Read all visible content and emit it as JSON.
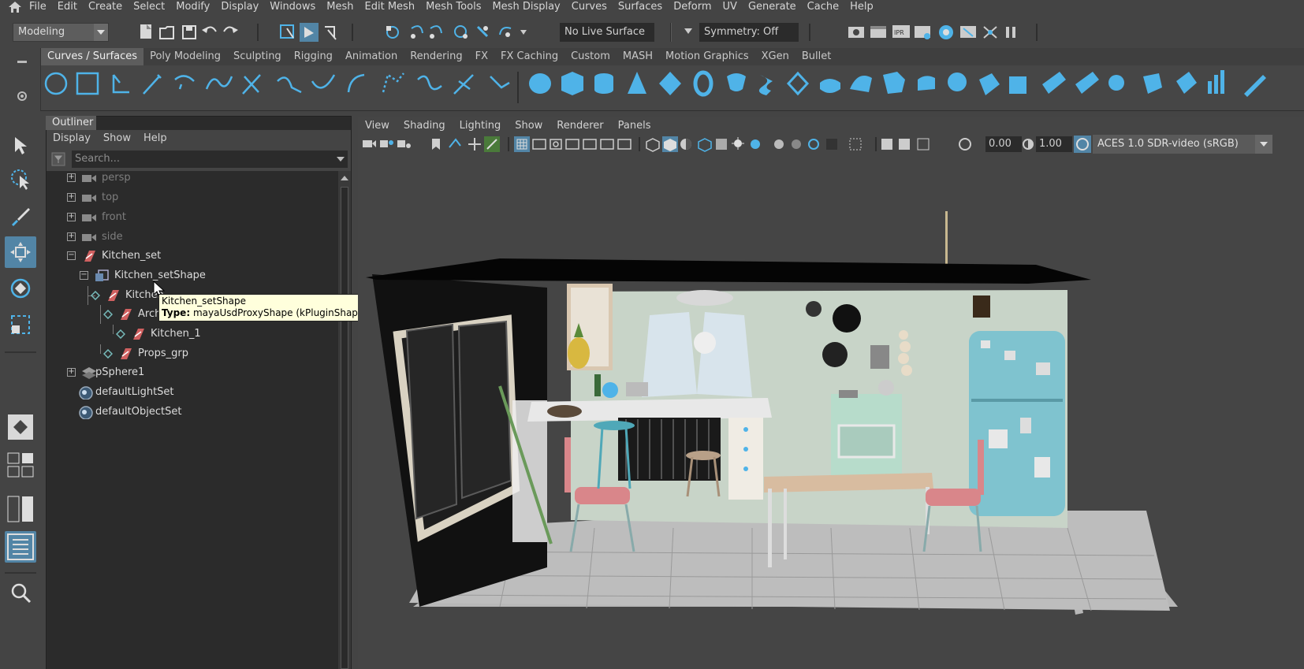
{
  "menubar": {
    "items": [
      "File",
      "Edit",
      "Create",
      "Select",
      "Modify",
      "Display",
      "Windows",
      "Mesh",
      "Edit Mesh",
      "Mesh Tools",
      "Mesh Display",
      "Curves",
      "Surfaces",
      "Deform",
      "UV",
      "Generate",
      "Cache",
      "Help"
    ]
  },
  "statusline": {
    "workspace": "Modeling",
    "live_surface": "No Live Surface",
    "symmetry": "Symmetry: Off"
  },
  "shelf": {
    "tabs": [
      "Curves / Surfaces",
      "Poly Modeling",
      "Sculpting",
      "Rigging",
      "Animation",
      "Rendering",
      "FX",
      "FX Caching",
      "Custom",
      "MASH",
      "Motion Graphics",
      "XGen",
      "Bullet"
    ],
    "active_tab": "Curves / Surfaces"
  },
  "outliner": {
    "tab": "Outliner",
    "menus": [
      "Display",
      "Show",
      "Help"
    ],
    "search_placeholder": "Search...",
    "rows": [
      {
        "label": "persp",
        "dim": true
      },
      {
        "label": "top",
        "dim": true
      },
      {
        "label": "front",
        "dim": true
      },
      {
        "label": "side",
        "dim": true
      },
      {
        "label": "Kitchen_set",
        "dim": false
      },
      {
        "label": "Kitchen_setShape",
        "dim": false
      },
      {
        "label": "Kitchen",
        "dim": false
      },
      {
        "label": "Arch_grp",
        "dim": false
      },
      {
        "label": "Kitchen_1",
        "dim": false
      },
      {
        "label": "Props_grp",
        "dim": false
      },
      {
        "label": "pSphere1",
        "dim": false
      },
      {
        "label": "defaultLightSet",
        "dim": false
      },
      {
        "label": "defaultObjectSet",
        "dim": false
      }
    ]
  },
  "tooltip": {
    "title": "Kitchen_setShape",
    "type_label": "Type:",
    "type_value": "mayaUsdProxyShape (kPluginShape)"
  },
  "viewport": {
    "menus": [
      "View",
      "Shading",
      "Lighting",
      "Show",
      "Renderer",
      "Panels"
    ],
    "exposure": "0.00",
    "gamma": "1.00",
    "color_space": "ACES 1.0 SDR-video (sRGB)"
  },
  "colors": {
    "accent": "#5285a6",
    "shelf_icon": "#4fb3e8"
  }
}
